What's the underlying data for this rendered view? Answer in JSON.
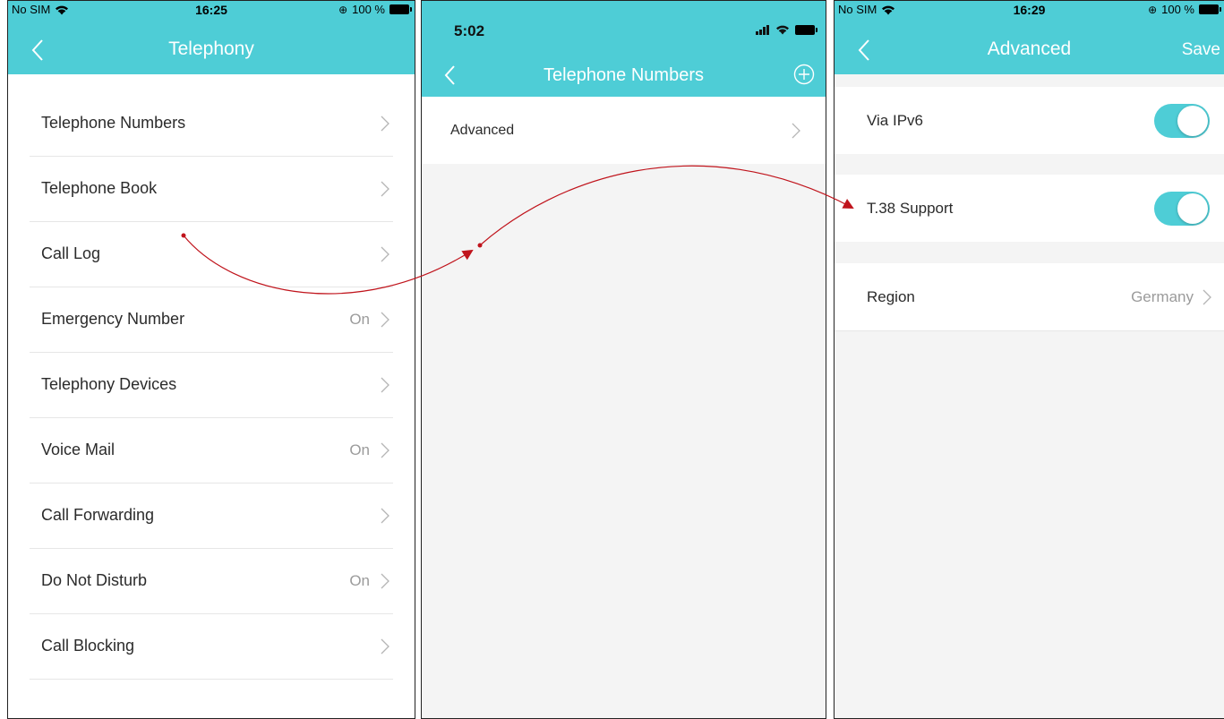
{
  "accent_color": "#4ecdd6",
  "arrow_color": "#c0141c",
  "phone1": {
    "status": {
      "carrier": "No SIM",
      "time": "16:25",
      "battery": "100 %"
    },
    "header": {
      "title": "Telephony"
    },
    "items": [
      {
        "label": "Telephone Numbers",
        "value": ""
      },
      {
        "label": "Telephone Book",
        "value": ""
      },
      {
        "label": "Call Log",
        "value": ""
      },
      {
        "label": "Emergency Number",
        "value": "On"
      },
      {
        "label": "Telephony Devices",
        "value": ""
      },
      {
        "label": "Voice Mail",
        "value": "On"
      },
      {
        "label": "Call Forwarding",
        "value": ""
      },
      {
        "label": "Do Not Disturb",
        "value": "On"
      },
      {
        "label": "Call Blocking",
        "value": ""
      }
    ]
  },
  "phone2": {
    "status": {
      "time": "5:02"
    },
    "header": {
      "title": "Telephone Numbers"
    },
    "items": [
      {
        "label": "Advanced"
      }
    ]
  },
  "phone3": {
    "status": {
      "carrier": "No SIM",
      "time": "16:29",
      "battery": "100 %"
    },
    "header": {
      "title": "Advanced",
      "save_label": "Save"
    },
    "via_ipv6": {
      "label": "Via IPv6",
      "enabled": true
    },
    "t38": {
      "label": "T.38 Support",
      "enabled": true
    },
    "region": {
      "label": "Region",
      "value": "Germany"
    }
  }
}
